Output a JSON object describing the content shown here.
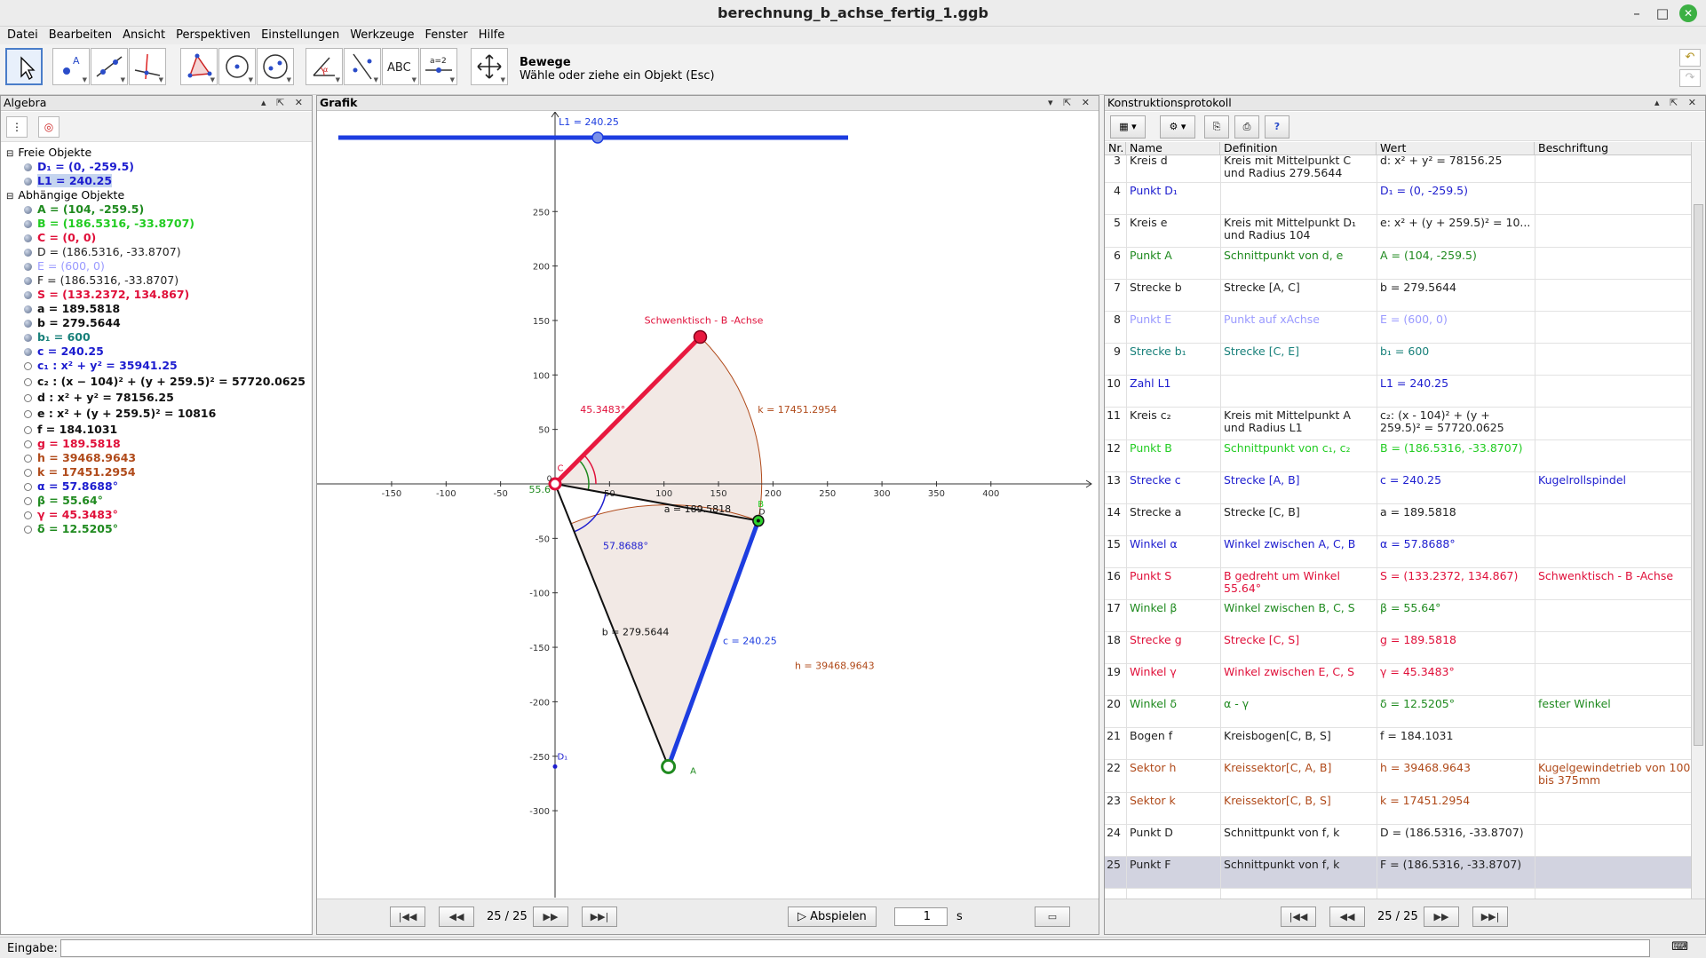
{
  "window": {
    "title": "berechnung_b_achse_fertig_1.ggb"
  },
  "menu": [
    "Datei",
    "Bearbeiten",
    "Ansicht",
    "Perspektiven",
    "Einstellungen",
    "Werkzeuge",
    "Fenster",
    "Hilfe"
  ],
  "toolbar": {
    "help_title": "Bewege",
    "help_text": "Wähle oder ziehe ein Objekt (Esc)",
    "tools": [
      "move-tool-icon",
      "point-tool-icon",
      "line-tool-icon",
      "perpendicular-tool-icon",
      "polygon-tool-icon",
      "circle-tool-icon",
      "ellipse-tool-icon",
      "angle-tool-icon",
      "reflect-tool-icon",
      "text-tool-icon",
      "slider-tool-icon",
      "move-view-tool-icon"
    ],
    "text_tool_label": "ABC",
    "slider_tool_label": "a=2"
  },
  "algebra": {
    "title": "Algebra",
    "groups": [
      {
        "label": "Freie Objekte",
        "items": [
          {
            "text": "D₁ = (0, -259.5)",
            "color": "#1d1dcf",
            "bold": true
          },
          {
            "text": "L1 = 240.25",
            "color": "#1d1dcf",
            "bold": true,
            "selected": true
          }
        ]
      },
      {
        "label": "Abhängige Objekte",
        "items": [
          {
            "text": "A = (104, -259.5)",
            "color": "#1f8a1f",
            "bold": true
          },
          {
            "text": "B = (186.5316, -33.8707)",
            "color": "#22cc22",
            "bold": true
          },
          {
            "text": "C = (0, 0)",
            "color": "#e0103a",
            "bold": true
          },
          {
            "text": "D = (186.5316, -33.8707)",
            "color": "#222222",
            "bold": false
          },
          {
            "text": "E = (600, 0)",
            "color": "#9a9aff",
            "bold": false
          },
          {
            "text": "F = (186.5316, -33.8707)",
            "color": "#222222",
            "bold": false
          },
          {
            "text": "S = (133.2372, 134.867)",
            "color": "#e0103a",
            "bold": true
          },
          {
            "text": "a = 189.5818",
            "color": "#111111",
            "bold": true
          },
          {
            "text": "b = 279.5644",
            "color": "#111111",
            "bold": true
          },
          {
            "text": "b₁ = 600",
            "color": "#18807a",
            "bold": true
          },
          {
            "text": "c = 240.25",
            "color": "#1d1dcf",
            "bold": true
          },
          {
            "text": "c₁ : x² + y² = 35941.25",
            "color": "#1d1dcf",
            "bold": true,
            "hollow": true
          },
          {
            "text": "c₂ : (x − 104)² + (y + 259.5)² = 57720.0625",
            "color": "#111111",
            "bold": true,
            "hollow": true
          },
          {
            "text": "d : x² + y² = 78156.25",
            "color": "#111111",
            "bold": true,
            "hollow": true
          },
          {
            "text": "e : x² + (y + 259.5)² = 10816",
            "color": "#111111",
            "bold": true,
            "hollow": true
          },
          {
            "text": "f = 184.1031",
            "color": "#111111",
            "bold": true,
            "hollow": true
          },
          {
            "text": "g = 189.5818",
            "color": "#e0103a",
            "bold": true,
            "hollow": true
          },
          {
            "text": "h = 39468.9643",
            "color": "#b04a1a",
            "bold": true,
            "hollow": true
          },
          {
            "text": "k = 17451.2954",
            "color": "#b04a1a",
            "bold": true,
            "hollow": true
          },
          {
            "text": "α = 57.8688°",
            "color": "#1d1dcf",
            "bold": true,
            "hollow": true
          },
          {
            "text": "β = 55.64°",
            "color": "#1f8a1f",
            "bold": true,
            "hollow": true
          },
          {
            "text": "γ = 45.3483°",
            "color": "#e0103a",
            "bold": true,
            "hollow": true
          },
          {
            "text": "δ = 12.5205°",
            "color": "#1f8a1f",
            "bold": true,
            "hollow": true
          }
        ]
      }
    ]
  },
  "grafik": {
    "title": "Grafik",
    "x_ticks": [
      "-150",
      "-100",
      "-50",
      "50",
      "100",
      "150",
      "200",
      "250",
      "300",
      "350",
      "400"
    ],
    "y_ticks": [
      "250",
      "200",
      "150",
      "100",
      "50",
      "-50",
      "-100",
      "-150",
      "-200",
      "-250",
      "-300"
    ],
    "labels": {
      "slider": "L1 = 240.25",
      "swing": "Schwenktisch - B -Achse",
      "k": "k = 17451.2954",
      "h": "h = 39468.9643",
      "gamma": "45.3483°",
      "alpha": "57.8688°",
      "beta_partial": "55.6",
      "a": "a = 189.5818",
      "b": "b = 279.5644",
      "c": "c = 240.25",
      "pt_C": "C",
      "pt_B": "B",
      "pt_D": "D",
      "pt_A": "A",
      "pt_D1": "D₁",
      "pt_O": "0"
    },
    "nav": {
      "position": "25 / 25",
      "play": "Abspielen",
      "speed": "1",
      "unit": "s"
    }
  },
  "protocol": {
    "title": "Konstruktionsprotokoll",
    "columns": [
      "Nr.",
      "Name",
      "Definition",
      "Wert",
      "Beschriftung"
    ],
    "rows": [
      {
        "nr": "3",
        "name": "Kreis d",
        "def": "Kreis mit Mittelpunkt C und Radius 279.5644",
        "val": "d: x² + y² = 78156.25",
        "cap": "",
        "color": "#222222"
      },
      {
        "nr": "4",
        "name": "Punkt D₁",
        "def": "",
        "val": "D₁ = (0, -259.5)",
        "cap": "",
        "color": "#1d1dcf"
      },
      {
        "nr": "5",
        "name": "Kreis e",
        "def": "Kreis mit Mittelpunkt D₁ und Radius 104",
        "val": "e: x² + (y + 259.5)² = 10...",
        "cap": "",
        "color": "#222222"
      },
      {
        "nr": "6",
        "name": "Punkt A",
        "def": "Schnittpunkt von d, e",
        "val": "A = (104, -259.5)",
        "cap": "",
        "color": "#1f8a1f"
      },
      {
        "nr": "7",
        "name": "Strecke b",
        "def": "Strecke [A, C]",
        "val": "b = 279.5644",
        "cap": "",
        "color": "#222222"
      },
      {
        "nr": "8",
        "name": "Punkt E",
        "def": "Punkt auf xAchse",
        "val": "E = (600, 0)",
        "cap": "",
        "color": "#9a9aff"
      },
      {
        "nr": "9",
        "name": "Strecke b₁",
        "def": "Strecke [C, E]",
        "val": "b₁ = 600",
        "cap": "",
        "color": "#18807a"
      },
      {
        "nr": "10",
        "name": "Zahl L1",
        "def": "",
        "val": "L1 = 240.25",
        "cap": "",
        "color": "#1d1dcf"
      },
      {
        "nr": "11",
        "name": "Kreis c₂",
        "def": "Kreis mit Mittelpunkt A und Radius L1",
        "val": "c₂: (x - 104)² + (y + 259.5)² = 57720.0625",
        "cap": "",
        "color": "#222222"
      },
      {
        "nr": "12",
        "name": "Punkt B",
        "def": "Schnittpunkt von c₁, c₂",
        "val": "B = (186.5316, -33.8707)",
        "cap": "",
        "color": "#22cc22"
      },
      {
        "nr": "13",
        "name": "Strecke c",
        "def": "Strecke [A, B]",
        "val": "c = 240.25",
        "cap": "Kugelrollspindel",
        "color": "#1d1dcf"
      },
      {
        "nr": "14",
        "name": "Strecke a",
        "def": "Strecke [C, B]",
        "val": "a = 189.5818",
        "cap": "",
        "color": "#222222"
      },
      {
        "nr": "15",
        "name": "Winkel α",
        "def": "Winkel zwischen A, C, B",
        "val": "α = 57.8688°",
        "cap": "",
        "color": "#1d1dcf"
      },
      {
        "nr": "16",
        "name": "Punkt S",
        "def": "B gedreht um Winkel 55.64°",
        "val": "S = (133.2372, 134.867)",
        "cap": "Schwenktisch - B -Achse",
        "color": "#e0103a"
      },
      {
        "nr": "17",
        "name": "Winkel β",
        "def": "Winkel zwischen B, C, S",
        "val": "β = 55.64°",
        "cap": "",
        "color": "#1f8a1f"
      },
      {
        "nr": "18",
        "name": "Strecke g",
        "def": "Strecke [C, S]",
        "val": "g = 189.5818",
        "cap": "",
        "color": "#e0103a"
      },
      {
        "nr": "19",
        "name": "Winkel γ",
        "def": "Winkel zwischen E, C, S",
        "val": "γ = 45.3483°",
        "cap": "",
        "color": "#e0103a"
      },
      {
        "nr": "20",
        "name": "Winkel δ",
        "def": "α - γ",
        "val": "δ = 12.5205°",
        "cap": "fester Winkel",
        "color": "#1f8a1f"
      },
      {
        "nr": "21",
        "name": "Bogen f",
        "def": "Kreisbogen[C, B, S]",
        "val": "f = 184.1031",
        "cap": "",
        "color": "#222222"
      },
      {
        "nr": "22",
        "name": "Sektor h",
        "def": "Kreissektor[C, A, B]",
        "val": "h = 39468.9643",
        "cap": "Kugelgewindetrieb von 100 bis 375mm",
        "color": "#b04a1a"
      },
      {
        "nr": "23",
        "name": "Sektor k",
        "def": "Kreissektor[C, B, S]",
        "val": "k = 17451.2954",
        "cap": "",
        "color": "#b04a1a"
      },
      {
        "nr": "24",
        "name": "Punkt D",
        "def": "Schnittpunkt von f, k",
        "val": "D = (186.5316, -33.8707)",
        "cap": "",
        "color": "#222222"
      },
      {
        "nr": "25",
        "name": "Punkt F",
        "def": "Schnittpunkt von f, k",
        "val": "F = (186.5316, -33.8707)",
        "cap": "",
        "color": "#222222",
        "current": true
      }
    ],
    "nav": {
      "position": "25 / 25"
    }
  },
  "input": {
    "label": "Eingabe:",
    "value": ""
  }
}
